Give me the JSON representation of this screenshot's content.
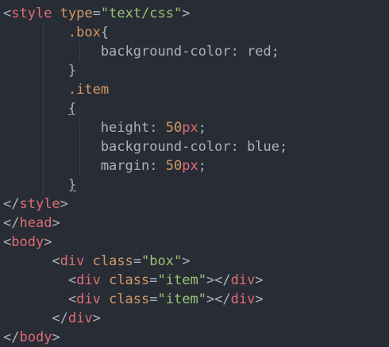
{
  "lines": [
    [
      {
        "t": "<",
        "c": "c-punct"
      },
      {
        "t": "style",
        "c": "c-tag"
      },
      {
        "t": " type",
        "c": "c-attr"
      },
      {
        "t": "=",
        "c": "c-punct"
      },
      {
        "t": "\"text/css\"",
        "c": "c-str"
      },
      {
        "t": ">",
        "c": "c-punct"
      }
    ],
    [
      {
        "t": "        .box",
        "c": "c-sel"
      },
      {
        "t": "{",
        "c": "c-punct"
      }
    ],
    [
      {
        "t": "            background-color",
        "c": "c-prop"
      },
      {
        "t": ": ",
        "c": "c-punct"
      },
      {
        "t": "red",
        "c": "c-plain"
      },
      {
        "t": ";",
        "c": "c-punct"
      }
    ],
    [
      {
        "t": "        }",
        "c": "c-punct"
      }
    ],
    [
      {
        "t": "        .item",
        "c": "c-sel"
      }
    ],
    [
      {
        "t": "        ",
        "c": "c-punct"
      },
      {
        "t": "{",
        "c": "c-punct ul"
      }
    ],
    [
      {
        "t": "            height",
        "c": "c-prop"
      },
      {
        "t": ": ",
        "c": "c-punct"
      },
      {
        "t": "50",
        "c": "c-num"
      },
      {
        "t": "px",
        "c": "c-tag"
      },
      {
        "t": ";",
        "c": "c-punct"
      }
    ],
    [
      {
        "t": "            background-color",
        "c": "c-prop"
      },
      {
        "t": ": ",
        "c": "c-punct"
      },
      {
        "t": "blue",
        "c": "c-plain"
      },
      {
        "t": ";",
        "c": "c-punct"
      }
    ],
    [
      {
        "t": "            margin",
        "c": "c-prop"
      },
      {
        "t": ": ",
        "c": "c-punct"
      },
      {
        "t": "50",
        "c": "c-num"
      },
      {
        "t": "px",
        "c": "c-tag"
      },
      {
        "t": ";",
        "c": "c-punct"
      }
    ],
    [
      {
        "t": "        ",
        "c": "c-punct"
      },
      {
        "t": "}",
        "c": "c-punct ul"
      }
    ],
    [
      {
        "t": "</",
        "c": "c-punct"
      },
      {
        "t": "style",
        "c": "c-tag"
      },
      {
        "t": ">",
        "c": "c-punct"
      }
    ],
    [
      {
        "t": "</",
        "c": "c-punct"
      },
      {
        "t": "head",
        "c": "c-tag"
      },
      {
        "t": ">",
        "c": "c-punct"
      }
    ],
    [
      {
        "t": "<",
        "c": "c-punct"
      },
      {
        "t": "body",
        "c": "c-tag"
      },
      {
        "t": ">",
        "c": "c-punct"
      }
    ],
    [
      {
        "t": "      <",
        "c": "c-punct"
      },
      {
        "t": "div",
        "c": "c-tag"
      },
      {
        "t": " class",
        "c": "c-attr"
      },
      {
        "t": "=",
        "c": "c-punct"
      },
      {
        "t": "\"box\"",
        "c": "c-str"
      },
      {
        "t": ">",
        "c": "c-punct"
      }
    ],
    [
      {
        "t": "        <",
        "c": "c-punct"
      },
      {
        "t": "div",
        "c": "c-tag"
      },
      {
        "t": " class",
        "c": "c-attr"
      },
      {
        "t": "=",
        "c": "c-punct"
      },
      {
        "t": "\"item\"",
        "c": "c-str"
      },
      {
        "t": "></",
        "c": "c-punct"
      },
      {
        "t": "div",
        "c": "c-tag"
      },
      {
        "t": ">",
        "c": "c-punct"
      }
    ],
    [
      {
        "t": "        <",
        "c": "c-punct"
      },
      {
        "t": "div",
        "c": "c-tag"
      },
      {
        "t": " class",
        "c": "c-attr"
      },
      {
        "t": "=",
        "c": "c-punct"
      },
      {
        "t": "\"item\"",
        "c": "c-str"
      },
      {
        "t": "></",
        "c": "c-punct"
      },
      {
        "t": "div",
        "c": "c-tag"
      },
      {
        "t": ">",
        "c": "c-punct"
      }
    ],
    [
      {
        "t": "      </",
        "c": "c-punct"
      },
      {
        "t": "div",
        "c": "c-tag"
      },
      {
        "t": ">",
        "c": "c-punct"
      }
    ],
    [
      {
        "t": "</",
        "c": "c-punct"
      },
      {
        "t": "body",
        "c": "c-tag"
      },
      {
        "t": ">",
        "c": "c-punct"
      }
    ]
  ]
}
